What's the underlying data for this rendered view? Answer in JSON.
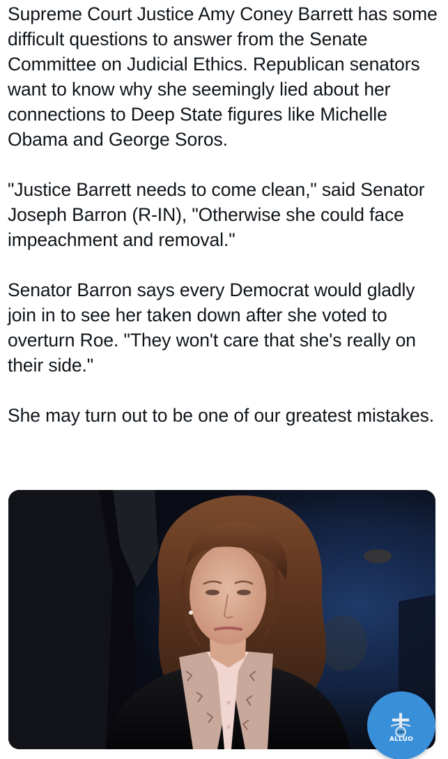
{
  "tweet": {
    "paragraphs": [
      "Supreme Court Justice Amy Coney Barrett has some difficult questions to answer from the Senate Committee on Judicial Ethics. Republican senators want to know why she seemingly lied about her connections to Deep State figures like Michelle Obama and George Soros.",
      "\"Justice Barrett needs to come clean,\" said Senator Joseph Barron (R-IN), \"Otherwise she could face impeachment and removal.\"",
      "Senator Barron says every Democrat would gladly join in to see her taken down after she voted to overturn Roe. \"They won't care that she's really on their side.\"",
      "She may turn out to be one of our greatest mistakes."
    ]
  },
  "media": {
    "type": "photo",
    "subject": "woman-portrait"
  },
  "fab": {
    "label": "ALLUO",
    "icon": "alluo-logo-icon",
    "color": "#3a8fd9"
  },
  "colors": {
    "text": "#0f1419",
    "background": "#ffffff",
    "accent": "#3a8fd9"
  }
}
